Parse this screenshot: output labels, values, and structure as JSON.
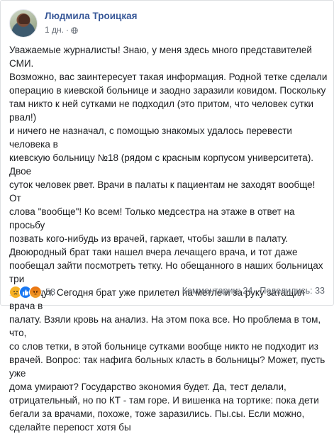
{
  "post": {
    "author": "Людмила Троицкая",
    "time": "1 дн.",
    "separator": "·",
    "text_lines": [
      "Уважаемые журналисты! Знаю, у меня здесь много представителей СМИ.",
      "Возможно, вас заинтересует такая информация. Родной тетке сделали",
      "операцию в киевской больнице и заодно заразили ковидом. Поскольку",
      "там никто к ней сутками не подходил (это притом, что человек сутки рвал!)",
      "и ничего не назначал, с помощью знакомых удалось перевести человека в",
      "киевскую больницу №18 (рядом с красным корпусом университета). Двое",
      "суток человек рвет. Врачи в палаты к пациентам не заходят вообще! От",
      "слова \"вообще\"! Ко всем! Только медсестра на этаже в ответ на просьбу",
      "позвать кого-нибудь из врачей, гаркает, чтобы зашли в палату.",
      "Двоюродный брат таки нашел вчера лечащего врача, и тот даже",
      "пообещал зайти посмотреть тетку. Но обещанного в наших больницах три",
      "года ждут. Сегодня брат уже прилетел на метле и за руку затащил врача в",
      "палату. Взяли кровь на анализ. На этом пока все. Но проблема в том, что,",
      "со слов тетки, в этой больнице сутками вообще никто не подходит из",
      "врачей. Вопрос: так нафига больных класть в больницы? Может, пусть уже",
      "дома умирают? Государство экономия будет. Да, тест делали,",
      "отрицательный, но по КТ - там горе. И вишенка на тортике: пока дети",
      "бегали за врачами, похоже, тоже заразились. Пы.сы. Если можно,",
      "сделайте перепост хотя бы"
    ]
  },
  "footer": {
    "reaction_icons": [
      "sad-icon",
      "like-icon",
      "angry-icon"
    ],
    "reactions_count": "58",
    "comments": "Комментарии: 24",
    "shares": "Поделились: 33"
  },
  "colors": {
    "author_link": "#385898",
    "text": "#1c1e21",
    "meta": "#616770",
    "like": "#1877f2",
    "sad": "#f7b125",
    "angry": "#e9710f"
  }
}
